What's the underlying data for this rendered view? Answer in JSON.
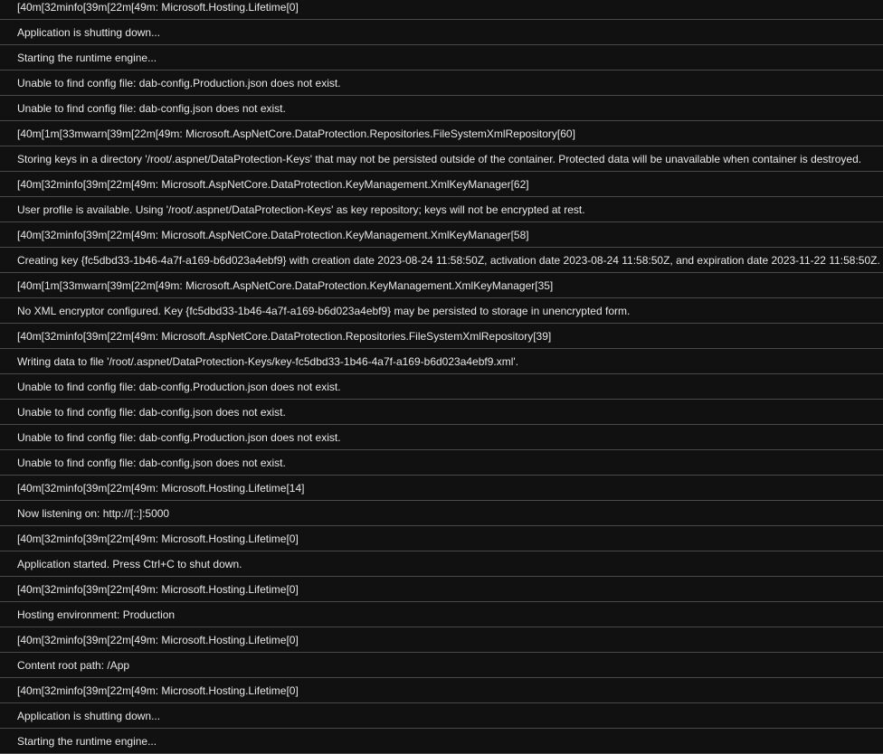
{
  "log_lines": [
    "[40m[32minfo[39m[22m[49m: Microsoft.Hosting.Lifetime[0]",
    "Application is shutting down...",
    "Starting the runtime engine...",
    "Unable to find config file: dab-config.Production.json does not exist.",
    "Unable to find config file: dab-config.json does not exist.",
    "[40m[1m[33mwarn[39m[22m[49m: Microsoft.AspNetCore.DataProtection.Repositories.FileSystemXmlRepository[60]",
    "Storing keys in a directory '/root/.aspnet/DataProtection-Keys' that may not be persisted outside of the container. Protected data will be unavailable when container is destroyed.",
    "[40m[32minfo[39m[22m[49m: Microsoft.AspNetCore.DataProtection.KeyManagement.XmlKeyManager[62]",
    "User profile is available. Using '/root/.aspnet/DataProtection-Keys' as key repository; keys will not be encrypted at rest.",
    "[40m[32minfo[39m[22m[49m: Microsoft.AspNetCore.DataProtection.KeyManagement.XmlKeyManager[58]",
    "Creating key {fc5dbd33-1b46-4a7f-a169-b6d023a4ebf9} with creation date 2023-08-24 11:58:50Z, activation date 2023-08-24 11:58:50Z, and expiration date 2023-11-22 11:58:50Z.",
    "[40m[1m[33mwarn[39m[22m[49m: Microsoft.AspNetCore.DataProtection.KeyManagement.XmlKeyManager[35]",
    "No XML encryptor configured. Key {fc5dbd33-1b46-4a7f-a169-b6d023a4ebf9} may be persisted to storage in unencrypted form.",
    "[40m[32minfo[39m[22m[49m: Microsoft.AspNetCore.DataProtection.Repositories.FileSystemXmlRepository[39]",
    "Writing data to file '/root/.aspnet/DataProtection-Keys/key-fc5dbd33-1b46-4a7f-a169-b6d023a4ebf9.xml'.",
    "Unable to find config file: dab-config.Production.json does not exist.",
    "Unable to find config file: dab-config.json does not exist.",
    "Unable to find config file: dab-config.Production.json does not exist.",
    "Unable to find config file: dab-config.json does not exist.",
    "[40m[32minfo[39m[22m[49m: Microsoft.Hosting.Lifetime[14]",
    "Now listening on: http://[::]:5000",
    "[40m[32minfo[39m[22m[49m: Microsoft.Hosting.Lifetime[0]",
    "Application started. Press Ctrl+C to shut down.",
    "[40m[32minfo[39m[22m[49m: Microsoft.Hosting.Lifetime[0]",
    "Hosting environment: Production",
    "[40m[32minfo[39m[22m[49m: Microsoft.Hosting.Lifetime[0]",
    "Content root path: /App",
    "[40m[32minfo[39m[22m[49m: Microsoft.Hosting.Lifetime[0]",
    "Application is shutting down...",
    "Starting the runtime engine..."
  ]
}
